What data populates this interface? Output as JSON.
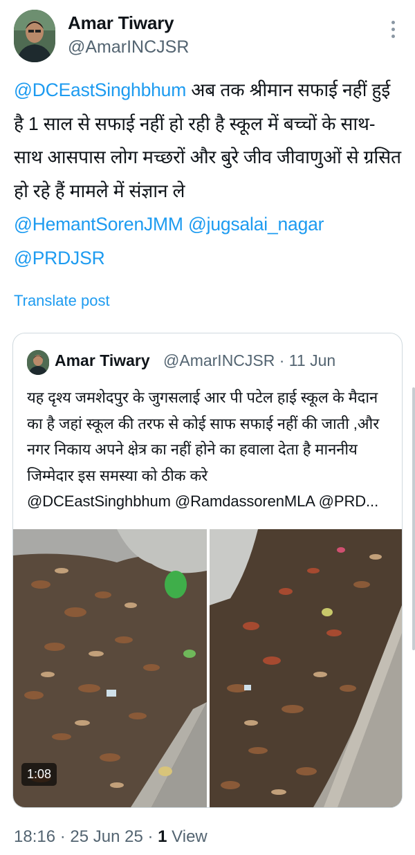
{
  "author": {
    "name": "Amar Tiwary",
    "handle": "@AmarINCJSR"
  },
  "tweet": {
    "mention_lead": "@DCEastSinghbhum",
    "body": " अब तक श्रीमान सफाई नहीं हुई है 1 साल से सफाई नहीं हो रही है स्कूल में बच्चों के साथ-साथ आसपास लोग मच्छरों और बुरे जीव जीवाणुओं से ग्रसित हो रहे हैं मामले में संज्ञान ले",
    "mention_1": "@HemantSorenJMM",
    "mention_2": "@jugsalai_nagar",
    "mention_3": "@PRDJSR",
    "translate_label": "Translate post"
  },
  "quoted": {
    "name": "Amar Tiwary",
    "handle_time": "@AmarINCJSR · 11 Jun",
    "text": "यह दृश्य जमशेदपुर के जुगसलाई आर पी पटेल हाई स्कूल के मैदान का है जहां स्कूल की तरफ से कोई साफ सफाई नहीं की जाती ,और नगर निकाय अपने क्षेत्र का नहीं होने का हवाला देता है माननीय जिम्मेदार इस समस्या को ठीक करे",
    "mentions": "@DCEastSinghbhum @RamdassorenMLA @PRD...",
    "video_duration": "1:08"
  },
  "footer": {
    "time_date": "18:16 · 25 Jun 25 · ",
    "views_count": "1",
    "views_label": " View"
  },
  "colors": {
    "link": "#1d9bf0",
    "secondary_text": "#536471",
    "border": "#cfd9de"
  }
}
